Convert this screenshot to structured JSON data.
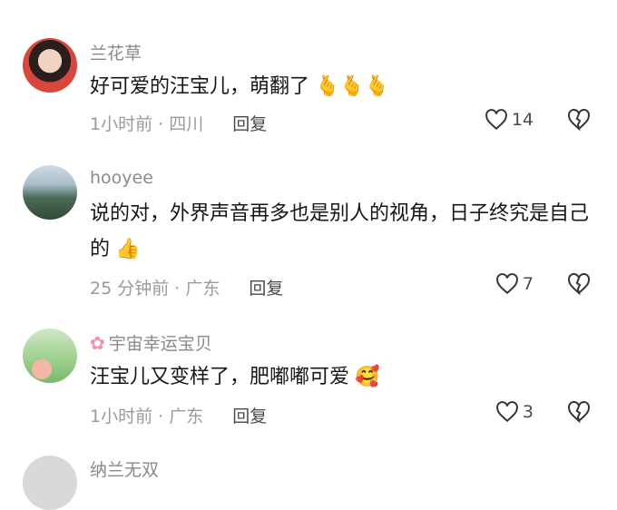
{
  "comments": [
    {
      "username": "兰花草",
      "text": "好可爱的汪宝儿，萌翻了",
      "emoji": "🫰🫰🫰",
      "time": "1小时前",
      "location": "四川",
      "reply_label": "回复",
      "likes": "14"
    },
    {
      "username": "hooyee",
      "text": "说的对，外界声音再多也是别人的视角，日子终究是自己的",
      "emoji": "👍",
      "time": "25 分钟前",
      "location": "广东",
      "reply_label": "回复",
      "likes": "7"
    },
    {
      "username": "宇宙幸运宝贝",
      "username_prefix_icon": "flower-icon",
      "text": "汪宝儿又变样了，肥嘟嘟可爱",
      "emoji": "🥰",
      "time": "1小时前",
      "location": "广东",
      "reply_label": "回复",
      "likes": "3"
    },
    {
      "username": "纳兰无双"
    }
  ],
  "separator": " · "
}
